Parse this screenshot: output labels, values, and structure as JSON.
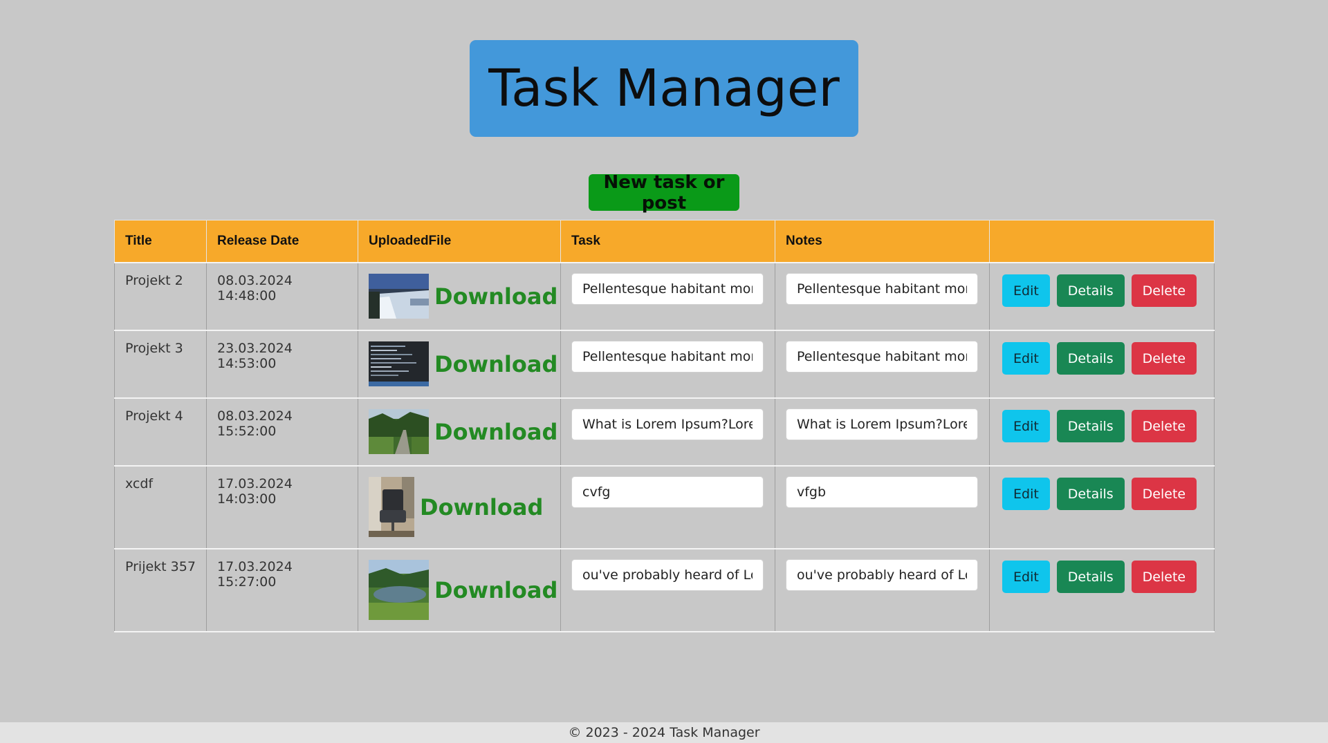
{
  "header": {
    "title": "Task Manager",
    "bg_color": "#4398da"
  },
  "actions": {
    "new_label": "New task or post",
    "new_color": "#0a9a18"
  },
  "table": {
    "columns": [
      "Title",
      "Release Date",
      "UploadedFile",
      "Task",
      "Notes",
      ""
    ],
    "header_color": "#f7a92a",
    "rows": [
      {
        "title": "Projekt 2",
        "release_date": "08.03.2024 14:48:00",
        "file_link": "Download",
        "thumb": "winter-lake-thumbnail",
        "task": "Pellentesque habitant morbi",
        "notes": "Pellentesque habitant morbi"
      },
      {
        "title": "Projekt 3",
        "release_date": "23.03.2024 14:53:00",
        "file_link": "Download",
        "thumb": "code-screen-thumbnail",
        "task": "Pellentesque habitant morbi",
        "notes": "Pellentesque habitant morbi"
      },
      {
        "title": "Projekt 4",
        "release_date": "08.03.2024 15:52:00",
        "file_link": "Download",
        "thumb": "forest-road-thumbnail",
        "task": "What is Lorem Ipsum?Lorem",
        "notes": "What is Lorem Ipsum?Lorem"
      },
      {
        "title": "xcdf",
        "release_date": "17.03.2024 14:03:00",
        "file_link": "Download",
        "thumb": "office-chair-thumbnail",
        "task": "cvfg",
        "notes": "vfgb"
      },
      {
        "title": "Prijekt 357",
        "release_date": "17.03.2024 15:27:00",
        "file_link": "Download",
        "thumb": "pond-thumbnail",
        "task": "ou've probably heard of Lor",
        "notes": "ou've probably heard of Lor"
      }
    ],
    "row_buttons": {
      "edit": "Edit",
      "details": "Details",
      "delete": "Delete"
    }
  },
  "footer": {
    "text": "© 2023 - 2024 Task Manager"
  }
}
